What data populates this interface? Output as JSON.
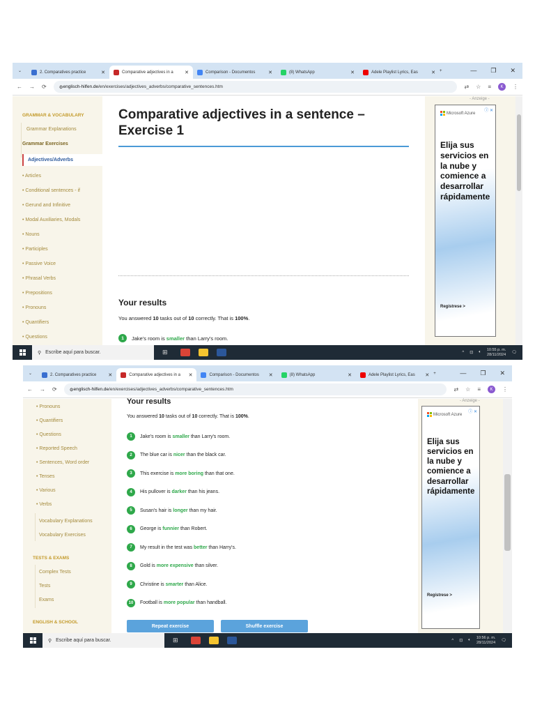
{
  "browser": {
    "tabs": [
      {
        "label": "2. Comparatives practice",
        "color": "#3a6fd0",
        "active": false
      },
      {
        "label": "Comparative adjectives in a",
        "color": "#c62828",
        "active": true
      },
      {
        "label": "Comparison - Documentos",
        "color": "#4285f4",
        "active": false
      },
      {
        "label": "(8) WhatsApp",
        "color": "#25d366",
        "active": false
      },
      {
        "label": "Adele Playlist Lyrics, Eas",
        "color": "#e00",
        "active": false
      }
    ],
    "new_tab": "+",
    "url_domain": "englisch-hilfen.de",
    "url_path": "/en/exercises/adjectives_adverbs/comparative_sentences.htm",
    "profile_initial": "K"
  },
  "sidebar": {
    "section_grammar": "GRAMMAR & VOCABULARY",
    "grammar_explanations": "Grammar Explanations",
    "grammar_exercises": "Grammar Exercises",
    "active_item": "Adjectives/Adverbs",
    "items": [
      "• Articles",
      "• Conditional sentences - if",
      "• Gerund and Infinitive",
      "• Modal Auxiliaries, Modals",
      "• Nouns",
      "• Participles",
      "• Passive Voice",
      "• Phrasal Verbs",
      "• Prepositions",
      "• Pronouns",
      "• Quantifiers",
      "• Questions",
      "• Reported Speech",
      "• Sentences, Word order",
      "• Tenses",
      "• Various",
      "• Verbs"
    ],
    "vocab_explanations": "Vocabulary Explanations",
    "vocab_exercises": "Vocabulary Exercises",
    "section_tests": "TESTS & EXAMS",
    "tests_items": [
      "Complex Tests",
      "Tests",
      "Exams"
    ],
    "section_school": "ENGLISH & SCHOOL"
  },
  "main": {
    "title": "Comparative adjectives in a sentence – Exercise 1",
    "results_heading": "Your results",
    "summary": {
      "pre": "You answered ",
      "correct": "10",
      "mid": " tasks out of ",
      "total": "10",
      "mid2": " correctly. That is ",
      "percent": "100%",
      "post": "."
    },
    "results": [
      {
        "n": "1",
        "pre": "Jake's room is ",
        "answer": "smaller",
        "post": " than Larry's room."
      },
      {
        "n": "2",
        "pre": "The blue car is ",
        "answer": "nicer",
        "post": " than the black car."
      },
      {
        "n": "3",
        "pre": "This exercise is ",
        "answer": "more boring",
        "post": " than that one."
      },
      {
        "n": "4",
        "pre": "His pullover is ",
        "answer": "darker",
        "post": " than his jeans."
      },
      {
        "n": "5",
        "pre": "Susan's hair is ",
        "answer": "longer",
        "post": " than my hair."
      },
      {
        "n": "6",
        "pre": "George is ",
        "answer": "funnier",
        "post": " than Robert."
      },
      {
        "n": "7",
        "pre": "My result in the test was ",
        "answer": "better",
        "post": " than Harry's."
      },
      {
        "n": "8",
        "pre": "Gold is ",
        "answer": "more expensive",
        "post": " than silver."
      },
      {
        "n": "9",
        "pre": "Christine is ",
        "answer": "smarter",
        "post": " than Alice."
      },
      {
        "n": "10",
        "pre": "Football is ",
        "answer": "more popular",
        "post": " than handball."
      }
    ],
    "repeat_button": "Repeat exercise",
    "shuffle_button": "Shuffle exercise"
  },
  "ad": {
    "label": "- Anzeige -",
    "brand": "Microsoft Azure",
    "headline": "Elija sus servicios en la nube y comience a desarrollar rápidamente",
    "cta": "Regístrese >",
    "adchoices": "ⓘ ✕"
  },
  "taskbar": {
    "search_placeholder": "Escribe aquí para buscar.",
    "time1": "10:55 p. m.",
    "time2": "10:56 p. m.",
    "date": "28/11/2024"
  },
  "colors": {
    "accent": "#4a9ad6",
    "correct": "#2ea84a",
    "sidebar_text": "#a48a3c"
  }
}
